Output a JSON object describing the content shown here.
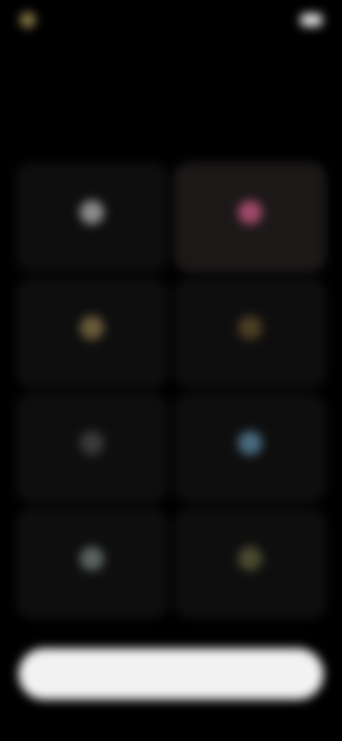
{
  "status_bar": {
    "time": "",
    "icons": ""
  },
  "header": {
    "back_label": "",
    "title": ""
  },
  "options": [
    {
      "label": "",
      "icon": "white-circle-icon",
      "icon_color": "#8c8c8c",
      "selected": false
    },
    {
      "label": "",
      "icon": "pink-circle-icon",
      "icon_color": "#a04a6a",
      "selected": true
    },
    {
      "label": "",
      "icon": "beige-circle-icon",
      "icon_color": "#6a5a3a",
      "selected": false
    },
    {
      "label": "",
      "icon": "small-gold-icon",
      "icon_color": "#4a3e22",
      "selected": false
    },
    {
      "label": "",
      "icon": "gray-circle-icon",
      "icon_color": "#3a3a3a",
      "selected": false
    },
    {
      "label": "",
      "icon": "blue-circle-icon",
      "icon_color": "#4a6a80",
      "selected": false
    },
    {
      "label": "",
      "icon": "gray-green-circle-icon",
      "icon_color": "#5a6460",
      "selected": false
    },
    {
      "label": "",
      "icon": "olive-circle-icon",
      "icon_color": "#4a4a30",
      "selected": false
    }
  ],
  "continue_button": {
    "label": ""
  },
  "colors": {
    "background": "#000000",
    "tile_background": "#0e0e0e",
    "selected_tile_background": "#1c1818",
    "button_background": "#f2f2f2"
  }
}
